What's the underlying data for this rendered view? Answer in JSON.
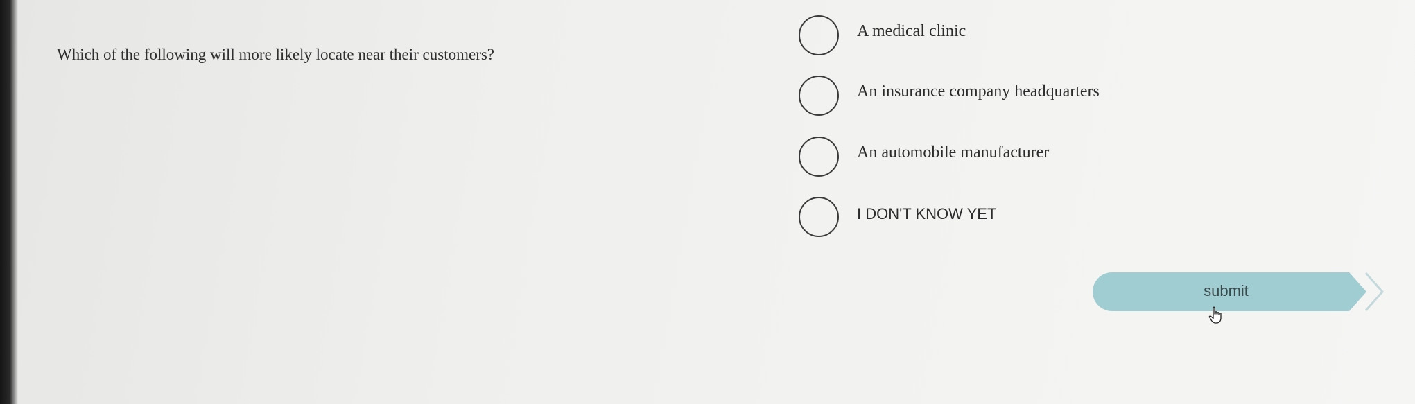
{
  "question": {
    "text": "Which of the following will more likely locate near their customers?"
  },
  "options": [
    {
      "label": "A medical clinic"
    },
    {
      "label": "An insurance company headquarters"
    },
    {
      "label": "An automobile manufacturer"
    },
    {
      "label": "I DON'T KNOW YET"
    }
  ],
  "submit": {
    "label": "submit",
    "color": "#9fcdd2"
  },
  "icons": {
    "radio": "radio-circle-icon",
    "chevron": "chevron-right-icon",
    "cursor": "hand-pointer-icon"
  }
}
